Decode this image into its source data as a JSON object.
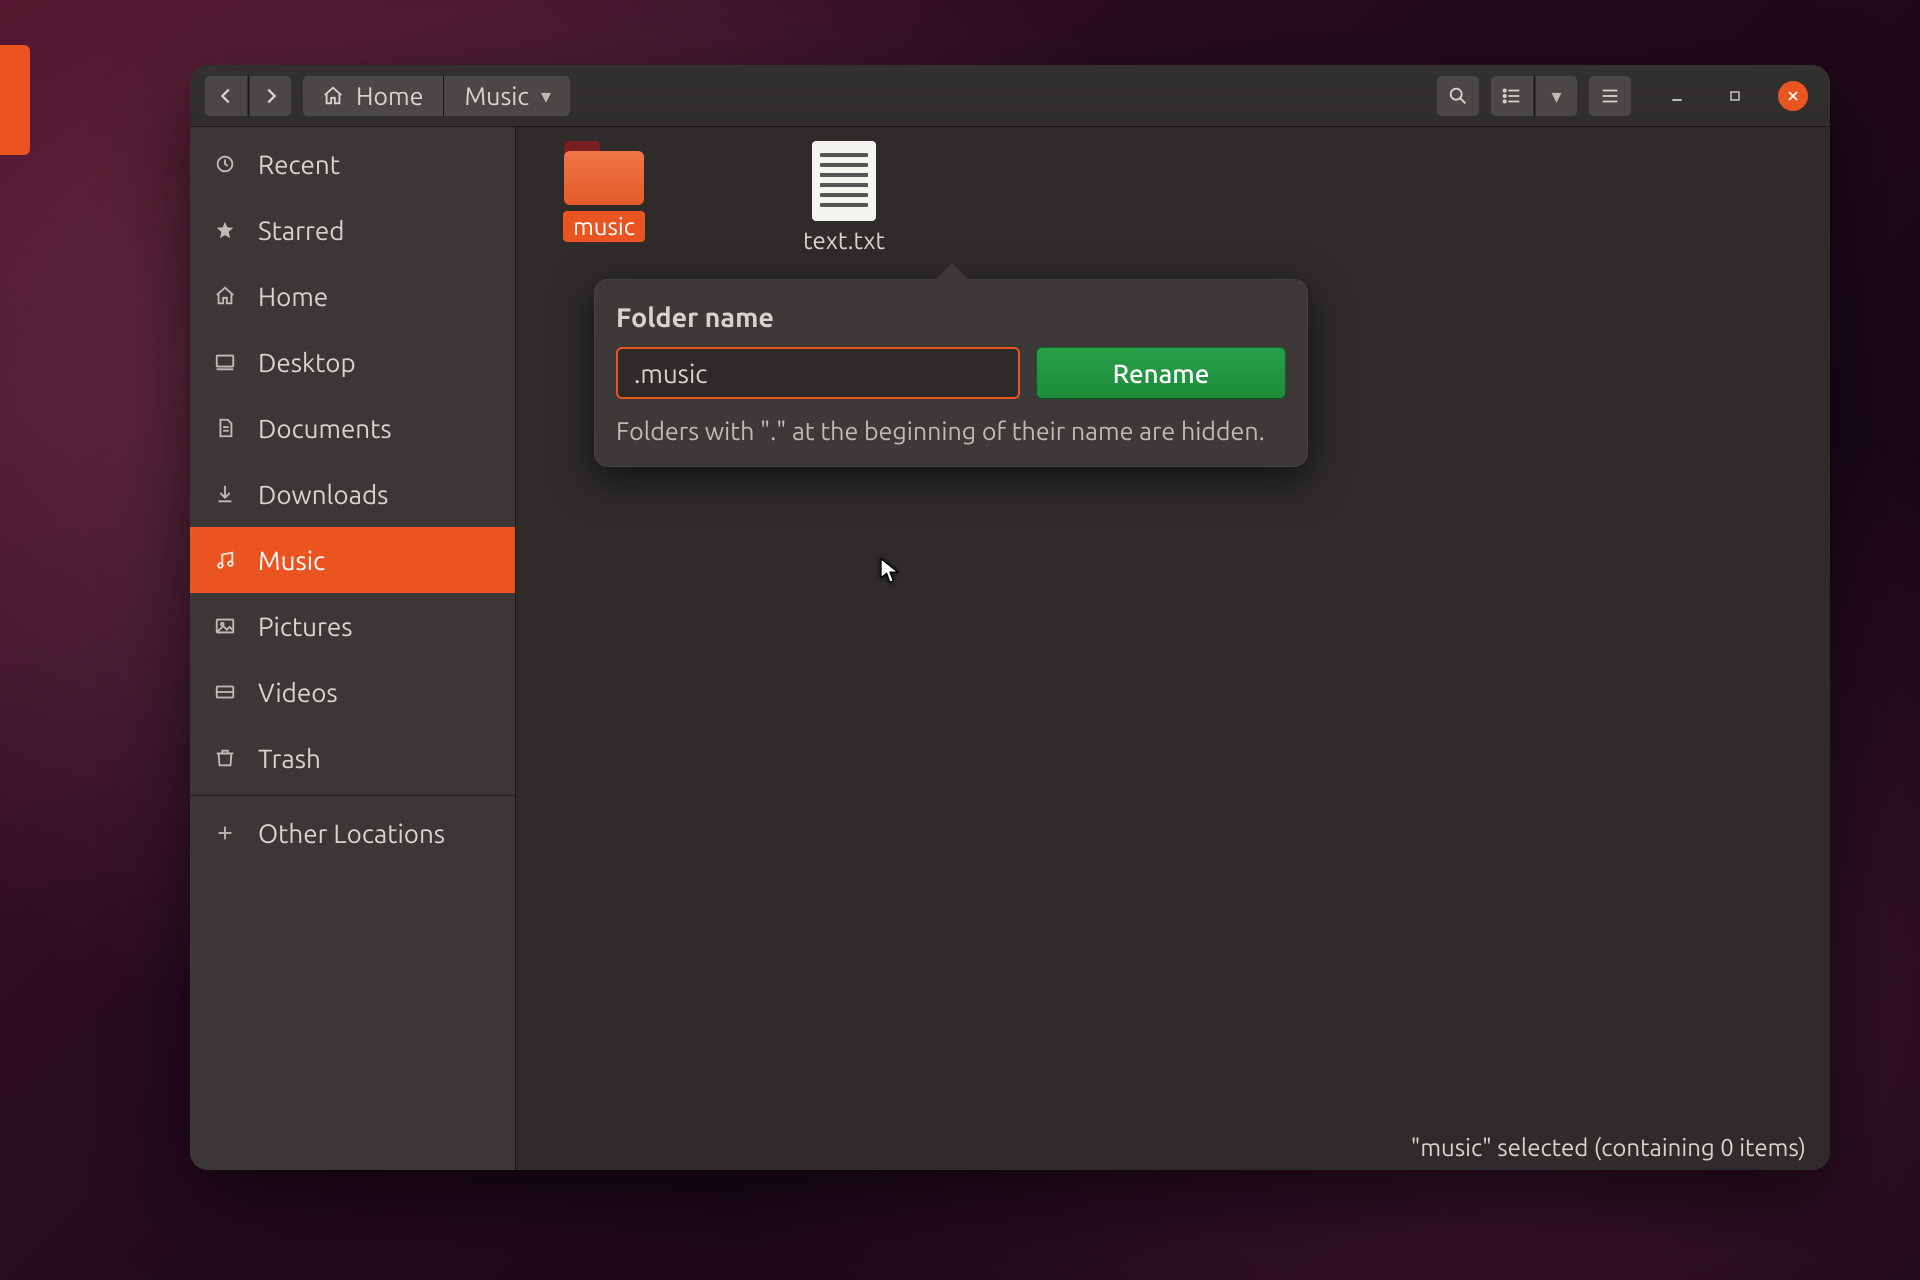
{
  "header": {
    "path_home": "Home",
    "path_current": "Music"
  },
  "sidebar": {
    "items": [
      {
        "icon": "clock",
        "label": "Recent",
        "name": "sidebar-item-recent"
      },
      {
        "icon": "star",
        "label": "Starred",
        "name": "sidebar-item-starred"
      },
      {
        "icon": "home",
        "label": "Home",
        "name": "sidebar-item-home"
      },
      {
        "icon": "desktop",
        "label": "Desktop",
        "name": "sidebar-item-desktop"
      },
      {
        "icon": "doc",
        "label": "Documents",
        "name": "sidebar-item-documents"
      },
      {
        "icon": "download",
        "label": "Downloads",
        "name": "sidebar-item-downloads"
      },
      {
        "icon": "music",
        "label": "Music",
        "name": "sidebar-item-music"
      },
      {
        "icon": "picture",
        "label": "Pictures",
        "name": "sidebar-item-pictures"
      },
      {
        "icon": "video",
        "label": "Videos",
        "name": "sidebar-item-videos"
      },
      {
        "icon": "trash",
        "label": "Trash",
        "name": "sidebar-item-trash"
      }
    ],
    "other_locations": "Other Locations",
    "active_index": 6
  },
  "files": {
    "items": [
      {
        "type": "folder",
        "label": "music",
        "selected": true,
        "name": "file-item-music"
      },
      {
        "type": "textfile",
        "label": "text.txt",
        "selected": false,
        "name": "file-item-text"
      }
    ]
  },
  "rename": {
    "title": "Folder name",
    "value": ".music",
    "button": "Rename",
    "hint": "Folders with \".\" at the beginning of their name are hidden."
  },
  "status": "\"music\" selected  (containing 0 items)"
}
